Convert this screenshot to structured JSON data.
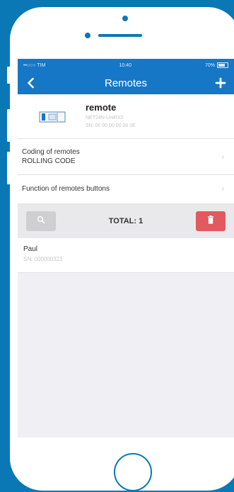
{
  "status_bar": {
    "carrier": "••○○○ TIM",
    "time": "10:40",
    "battery": "70%"
  },
  "nav": {
    "title": "Remotes",
    "back_icon": "chevron-left-icon",
    "add_icon": "plus-icon"
  },
  "device": {
    "name": "remote",
    "model": "NET24N-UniRX0",
    "sn": "SN: 00 00 00 00 00 0E",
    "icon": "remote-device-icon"
  },
  "settings": [
    {
      "title": "Coding of remotes",
      "value": "ROLLING CODE"
    },
    {
      "title": "Function of remotes buttons"
    }
  ],
  "toolbar": {
    "total": "TOTAL: 1",
    "search_icon": "search-icon",
    "delete_icon": "trash-icon"
  },
  "remotes": [
    {
      "name": "Paul",
      "sn": "SN: 000000321"
    }
  ],
  "colors": {
    "brand_blue": "#1677c6",
    "frame_blue": "#0b78b6",
    "delete_red": "#e05a60",
    "search_gray": "#cfcfd2"
  }
}
